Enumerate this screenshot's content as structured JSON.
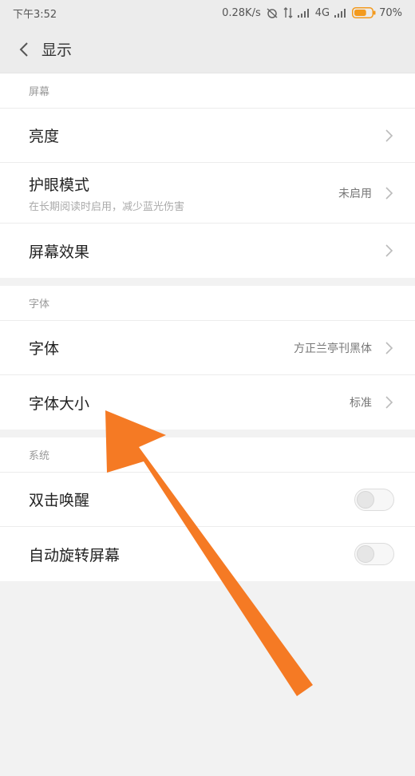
{
  "status_bar": {
    "time": "下午3:52",
    "network_speed": "0.28K/s",
    "network_type": "4G",
    "battery": "70%",
    "battery_level": 0.7,
    "battery_color": "#f39a1e"
  },
  "header": {
    "title": "显示"
  },
  "sections": [
    {
      "header": "屏幕",
      "rows": [
        {
          "title": "亮度"
        },
        {
          "title": "护眼模式",
          "subtitle": "在长期阅读时启用，减少蓝光伤害",
          "value": "未启用"
        },
        {
          "title": "屏幕效果"
        }
      ]
    },
    {
      "header": "字体",
      "rows": [
        {
          "title": "字体",
          "value": "方正兰亭刊黑体"
        },
        {
          "title": "字体大小",
          "value": "标准"
        }
      ]
    },
    {
      "header": "系统",
      "rows": [
        {
          "title": "双击唤醒",
          "toggle": false
        },
        {
          "title": "自动旋转屏幕",
          "toggle": false
        }
      ]
    }
  ],
  "annotation": {
    "arrow_color": "#f57a24",
    "icon": "arrow-pointing-to-font-size"
  }
}
